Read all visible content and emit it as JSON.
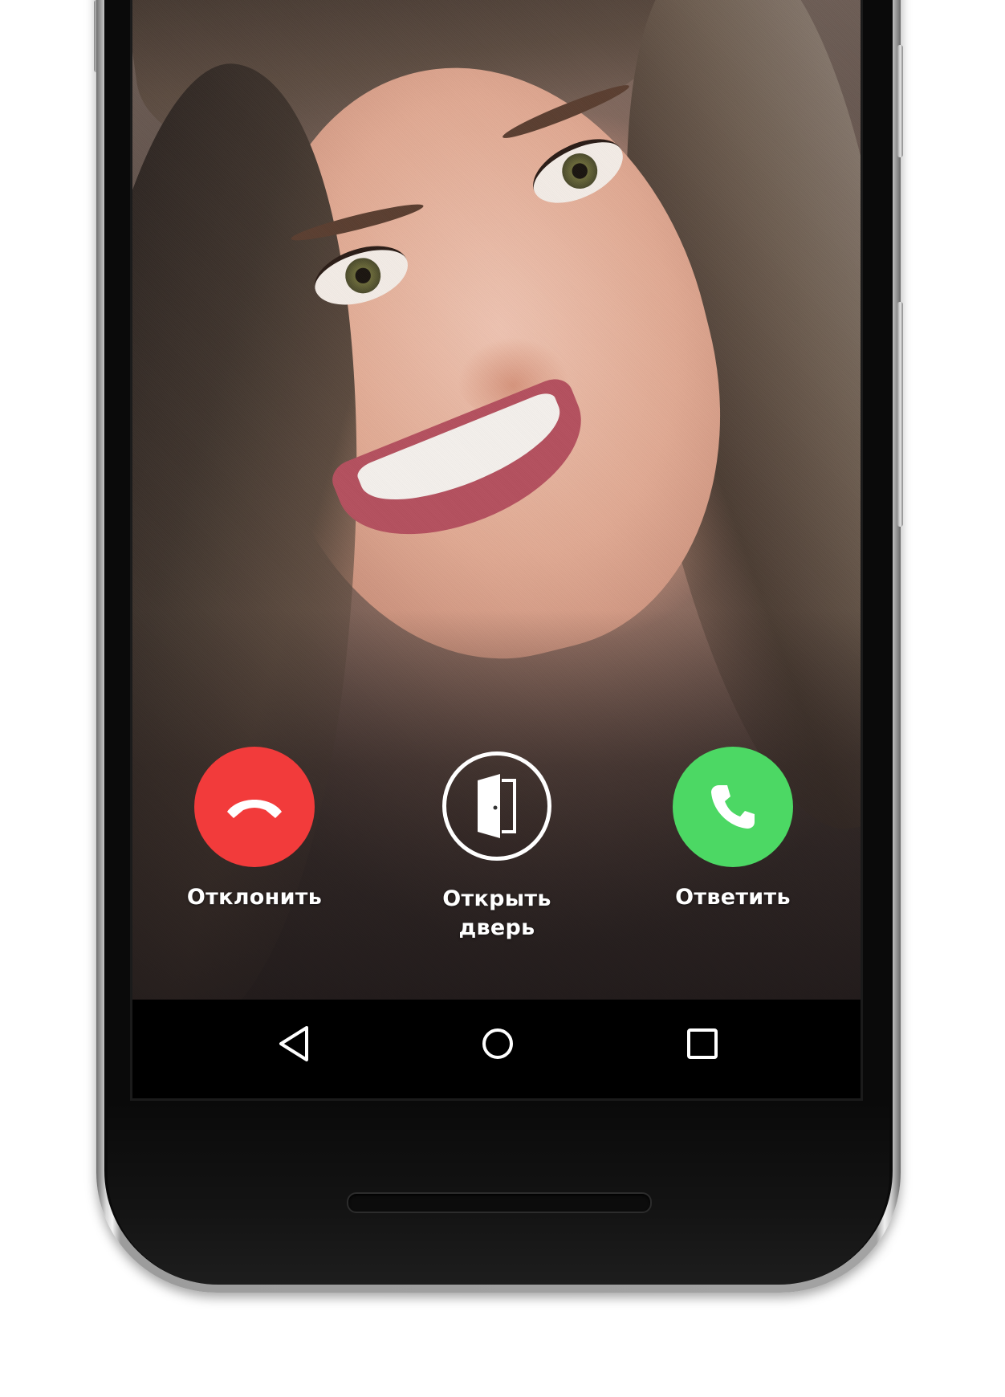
{
  "call_screen": {
    "actions": [
      {
        "id": "decline",
        "label": "Отклонить",
        "icon": "phone-hangup-icon",
        "color": "#f23b3b"
      },
      {
        "id": "open_door",
        "label": "Открыть\nдверь",
        "icon": "door-open-icon",
        "color": "#ffffff"
      },
      {
        "id": "answer",
        "label": "Ответить",
        "icon": "phone-icon",
        "color": "#4cd864"
      }
    ]
  },
  "navbar": {
    "buttons": [
      {
        "id": "back",
        "icon": "back-triangle-icon"
      },
      {
        "id": "home",
        "icon": "home-circle-icon"
      },
      {
        "id": "recents",
        "icon": "recents-square-icon"
      }
    ]
  }
}
